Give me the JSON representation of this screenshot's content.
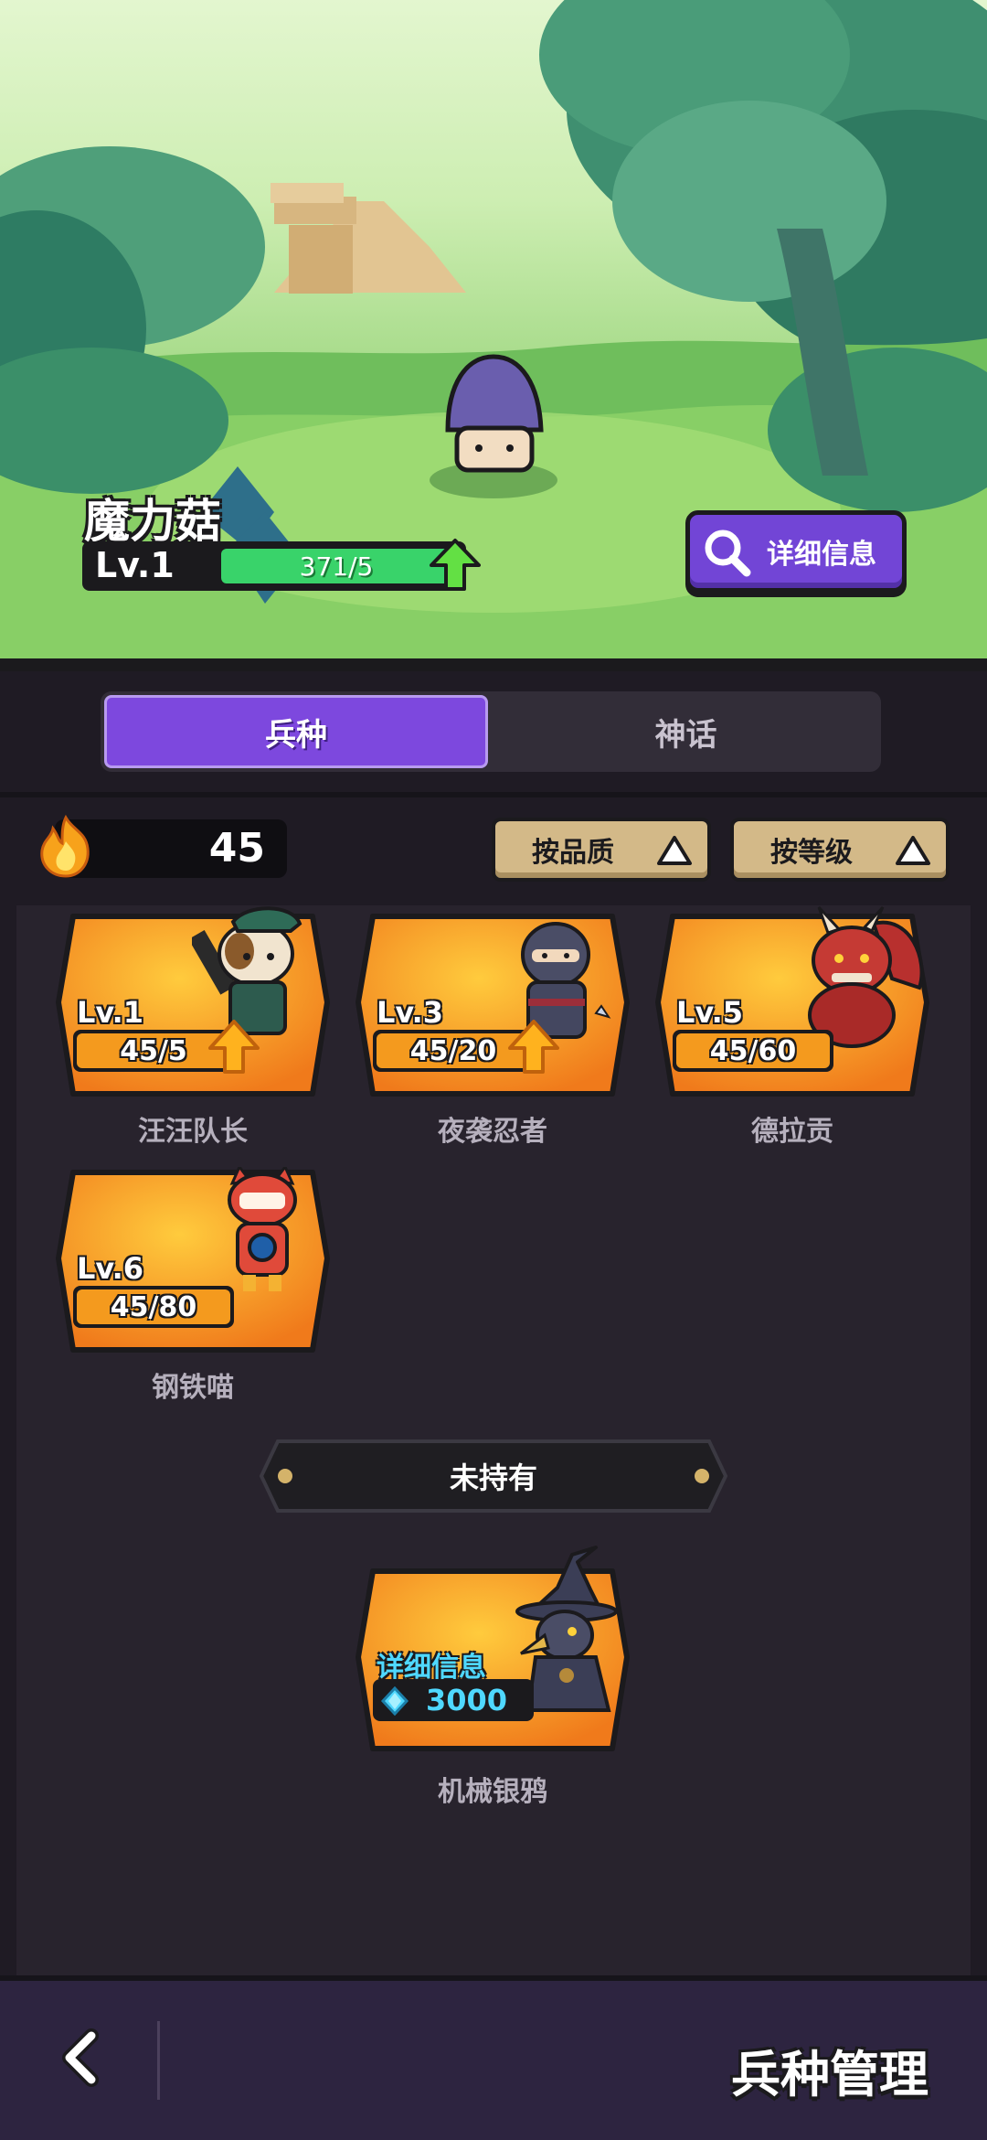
{
  "hero": {
    "name": "魔力菇",
    "level": "Lv.1",
    "exp": "371/5",
    "detail_label": "详细信息"
  },
  "tabs": [
    {
      "label": "兵种",
      "active": true
    },
    {
      "label": "神话",
      "active": false
    }
  ],
  "resource": {
    "icon": "fire-icon",
    "count": "45"
  },
  "sort": {
    "quality_label": "按品质",
    "level_label": "按等级"
  },
  "owned_units": [
    {
      "name": "汪汪队长",
      "level": "Lv.1",
      "progress": "45/5",
      "upgradable": true
    },
    {
      "name": "夜袭忍者",
      "level": "Lv.3",
      "progress": "45/20",
      "upgradable": true
    },
    {
      "name": "德拉贡",
      "level": "Lv.5",
      "progress": "45/60",
      "upgradable": false
    },
    {
      "name": "钢铁喵",
      "level": "Lv.6",
      "progress": "45/80",
      "upgradable": false
    }
  ],
  "unowned_section": {
    "title": "未持有"
  },
  "unowned_units": [
    {
      "name": "机械银鸦",
      "info_label": "详细信息",
      "price": "3000",
      "currency_icon": "gem-icon"
    }
  ],
  "footer": {
    "title": "兵种管理"
  },
  "colors": {
    "accent_purple": "#7d48de",
    "card_orange": "#f49a1e",
    "exp_green": "#39d36a",
    "gem_cyan": "#4fd8ff"
  }
}
